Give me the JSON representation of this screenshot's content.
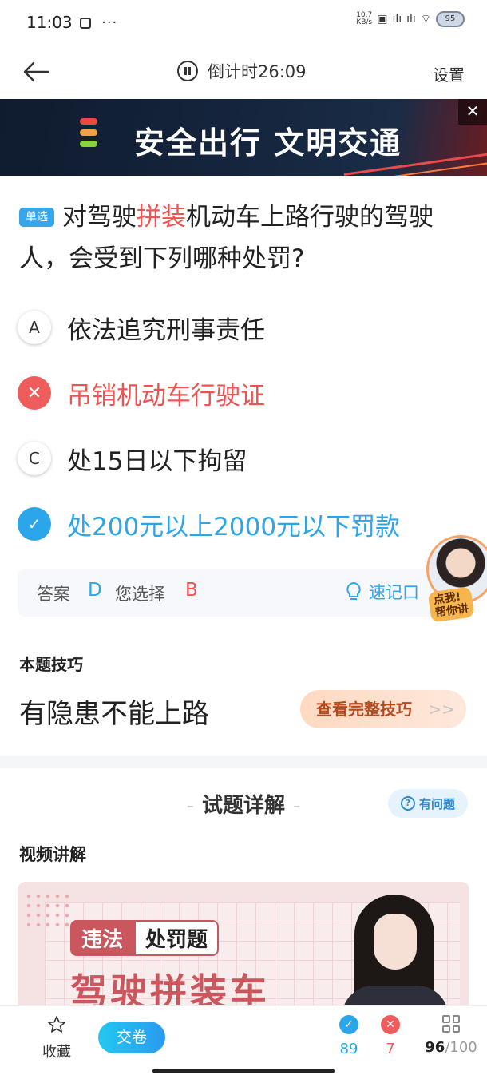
{
  "status_bar": {
    "time": "11:03",
    "net_speed": "10.7\nKB/s",
    "battery": "95"
  },
  "header": {
    "countdown": "倒计时26:09",
    "settings_label": "设置"
  },
  "banner": {
    "text": "安全出行 文明交通",
    "close_label": "✕",
    "traffic_light_colors": [
      "#e94a3f",
      "#f2a23a",
      "#8bd33a"
    ]
  },
  "question": {
    "type_tag": "单选",
    "text_before": "对驾驶",
    "text_highlight": "拼装",
    "text_after": "机动车上路行驶的驾驶人，会受到下列哪种处罚?"
  },
  "options": [
    {
      "marker": "A",
      "text": "依法追究刑事责任",
      "state": "normal"
    },
    {
      "marker": "✕",
      "text": "吊销机动车行驶证",
      "state": "wrong"
    },
    {
      "marker": "C",
      "text": "处15日以下拘留",
      "state": "normal"
    },
    {
      "marker": "✓",
      "text": "处200元以上2000元以下罚款",
      "state": "correct"
    }
  ],
  "answer_box": {
    "answer_label": "答案",
    "answer_value": "D",
    "your_choice_label": "您选择",
    "your_choice_value": "B",
    "quick_memo_label": "速记口"
  },
  "assistant": {
    "tag": "点我!\n帮你讲"
  },
  "tip": {
    "title": "本题技巧",
    "text": "有隐患不能上路",
    "button_label": "查看完整技巧",
    "button_chevron": ">>"
  },
  "explanation": {
    "title": "试题详解",
    "question_button": "有问题",
    "video_title": "视频讲解",
    "video_tag1": "违法",
    "video_tag2": "处罚题",
    "video_headline": "驾驶拼装车"
  },
  "bottom_bar": {
    "favorite_label": "收藏",
    "submit_label": "交卷",
    "correct_count": "89",
    "wrong_count": "7",
    "progress_current": "96",
    "progress_total": "/100"
  },
  "colors": {
    "accent_blue": "#2ba6ea",
    "error_red": "#f0524f",
    "tip_orange": "#b54a1e"
  }
}
